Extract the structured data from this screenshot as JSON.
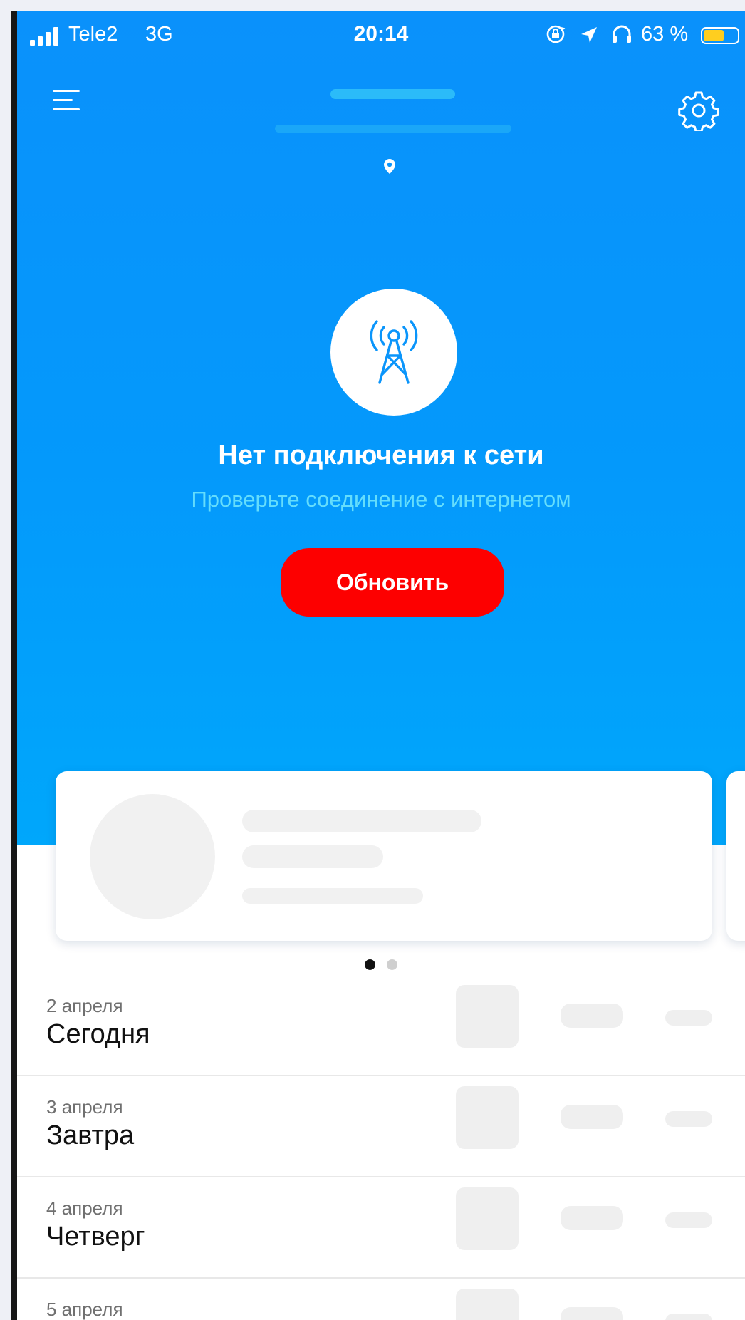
{
  "status_bar": {
    "carrier": "Tele2",
    "network": "3G",
    "time": "20:14",
    "battery_percent": "63 %",
    "battery_level": 0.63,
    "icons": [
      "signal-icon",
      "rotation-lock-icon",
      "location-arrow-icon",
      "headphones-icon",
      "battery-icon"
    ]
  },
  "header": {
    "icons": [
      "menu-icon",
      "gear-icon",
      "location-pin-icon"
    ]
  },
  "offline": {
    "icon": "radio-tower-icon",
    "title": "Нет подключения к сети",
    "subtitle": "Проверьте соединение с интернетом",
    "button_label": "Обновить"
  },
  "carousel": {
    "page_count": 2,
    "active_page": 1
  },
  "forecast": [
    {
      "date": "2 апреля",
      "day": "Сегодня"
    },
    {
      "date": "3 апреля",
      "day": "Завтра"
    },
    {
      "date": "4 апреля",
      "day": "Четверг"
    },
    {
      "date": "5 апреля",
      "day": ""
    }
  ],
  "colors": {
    "hero_gradient_top": "#0a91fb",
    "hero_gradient_bottom": "#00a7fb",
    "button": "#fd0000",
    "subtitle": "#64ddfc",
    "battery_fill": "#ffce1f",
    "skeleton": "#efefef"
  }
}
